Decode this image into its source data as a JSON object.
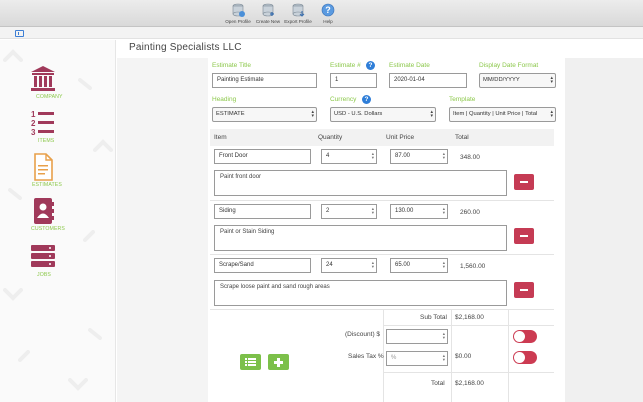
{
  "toolbar": {
    "open_profile": "Open Profile",
    "create_new": "Create New",
    "export_profile": "Export Profile",
    "help": "Help"
  },
  "sidebar": {
    "items": [
      {
        "label": "COMPANY",
        "icon": "bank-icon"
      },
      {
        "label": "ITEMS",
        "icon": "numbered-list-icon"
      },
      {
        "label": "ESTIMATES",
        "icon": "document-icon"
      },
      {
        "label": "CUSTOMERS",
        "icon": "contacts-book-icon"
      },
      {
        "label": "JOBS",
        "icon": "jobs-stack-icon"
      }
    ]
  },
  "page": {
    "title": "Painting Specialists LLC"
  },
  "form": {
    "estimate_title_label": "Estimate Title",
    "estimate_title_value": "Painting Estimate",
    "estimate_number_label": "Estimate #",
    "estimate_number_value": "1",
    "estimate_date_label": "Estimate Date",
    "estimate_date_value": "2020-01-04",
    "display_date_format_label": "Display Date Format",
    "display_date_format_value": "MM/DD/YYYY",
    "heading_label": "Heading",
    "heading_value": "ESTIMATE",
    "currency_label": "Currency",
    "currency_value": "USD - U.S. Dollars",
    "template_label": "Template",
    "template_value": "Item | Quantity | Unit Price | Total"
  },
  "table": {
    "headers": {
      "item": "Item",
      "quantity": "Quantity",
      "unit_price": "Unit Price",
      "total": "Total"
    },
    "rows": [
      {
        "item": "Front Door",
        "quantity": "4",
        "unit_price": "87.00",
        "total": "348.00",
        "description": "Paint front door"
      },
      {
        "item": "Siding",
        "quantity": "2",
        "unit_price": "130.00",
        "total": "260.00",
        "description": "Paint or Stain Siding"
      },
      {
        "item": "Scrape/Sand",
        "quantity": "24",
        "unit_price": "65.00",
        "total": "1,560.00",
        "description": "Scrape loose paint and sand rough areas"
      }
    ]
  },
  "summary": {
    "subtotal_label": "Sub Total",
    "subtotal_value": "$2,168.00",
    "discount_label": "(Discount) $",
    "discount_value": "",
    "sales_tax_label": "Sales Tax %",
    "sales_tax_placeholder": "%",
    "sales_tax_value": "$0.00",
    "total_label": "Total",
    "total_value": "$2,168.00"
  },
  "colors": {
    "accent_green": "#8cc84b",
    "brand_maroon": "#a0395a",
    "danger_red": "#c53b54",
    "help_blue": "#2f7ed8"
  }
}
